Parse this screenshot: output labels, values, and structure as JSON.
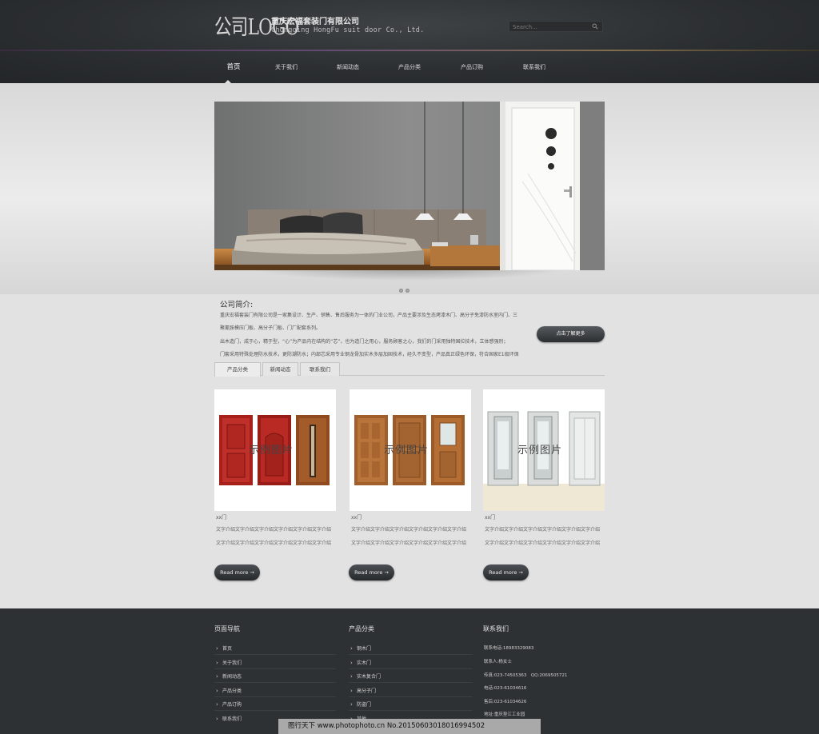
{
  "header": {
    "logo": "公司LOGO",
    "company_name_cn": "重庆宏福套装门有限公司",
    "company_name_en": "Chongqing HongFu suit door Co., Ltd.",
    "search_placeholder": "Search..."
  },
  "nav": {
    "items": [
      {
        "label": "首页",
        "active": true
      },
      {
        "label": "关于我们"
      },
      {
        "label": "新闻动态"
      },
      {
        "label": "产品分类"
      },
      {
        "label": "产品订购"
      },
      {
        "label": "联系我们"
      }
    ]
  },
  "intro": {
    "title": "公司简介:",
    "paragraphs": [
      "重庆宏福套装门有限公司是一家集设计、生产、销售、售后服务为一体的门业公司，产品主要涉及生态烤漆木门、高分子免漆防水室内门、三",
      "聚氰胺模压门板、高分子门板、门厂配套系列。",
      "出木造门，成于心，精于型，“心”为产品内在结构的“芯”，也为造门之用心，服务顾客之心，我们的门采用独特国拉技术，立体感强烈；",
      "门套采用特殊处理防水技术，更防潮防水；内部芯采用专业钢龙骨加实木多层加固技术，经久不变型，产品真正绿色环保，符合国家E1级环保"
    ],
    "more_button": "点击了解更多"
  },
  "tabs": [
    "产品分类",
    "新闻动态",
    "联系我们"
  ],
  "products": [
    {
      "image_label": "示例图片",
      "name": "xx门",
      "desc": "文字介绍文字介绍文字介绍文字介绍文字介绍文字介绍",
      "button": "Read more →"
    },
    {
      "image_label": "示例图片",
      "name": "xx门",
      "desc": "文字介绍文字介绍文字介绍文字介绍文字介绍文字介绍",
      "button": "Read more →"
    },
    {
      "image_label": "示例图片",
      "name": "xx门",
      "desc": "文字介绍文字介绍文字介绍文字介绍文字介绍文字介绍",
      "button": "Read more →"
    }
  ],
  "footer": {
    "nav_title": "页面导航",
    "nav_items": [
      "首页",
      "关于我们",
      "新闻动态",
      "产品分类",
      "产品订购",
      "联系我们"
    ],
    "category_title": "产品分类",
    "category_items": [
      "钢木门",
      "实木门",
      "实木复合门",
      "高分子门",
      "防盗门",
      "其他"
    ],
    "contact_title": "联系我们",
    "contact_lines": [
      "联系电话:18983329083",
      "联系人:杨女士",
      "传真:023-74505363　QQ:2069505721",
      "电话:023-61034616",
      "售后:023-61034626",
      "地址:重庆垫江工业园"
    ]
  },
  "watermark": "图行天下 www.photophoto.cn  No.20150603018016994502"
}
